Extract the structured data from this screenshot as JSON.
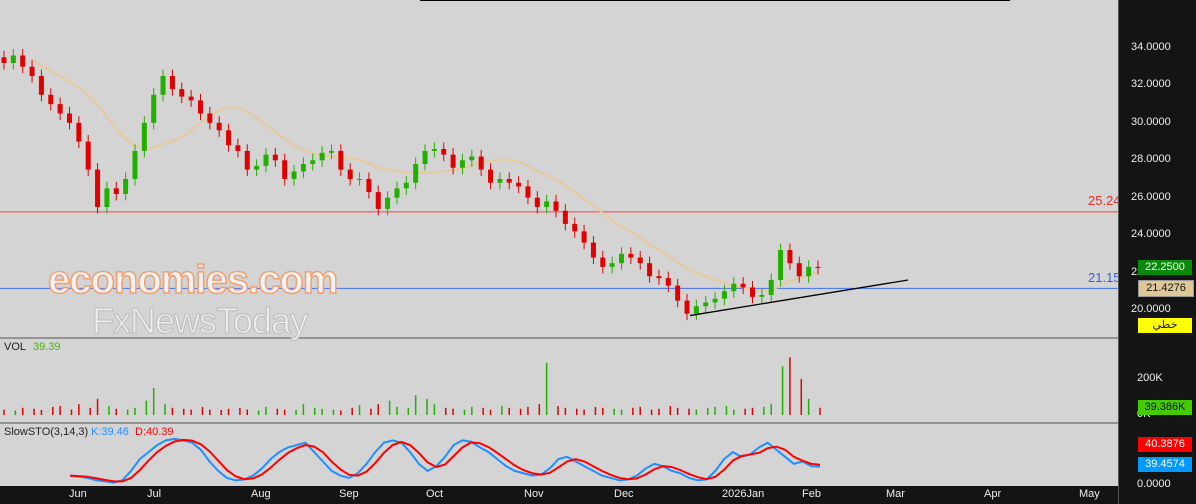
{
  "watermark": {
    "line1": "economies.com",
    "line2": "FxNewsToday"
  },
  "price_axis": {
    "ticks": [
      "34.0000",
      "32.0000",
      "30.0000",
      "28.0000",
      "26.0000",
      "24.0000",
      "22.0000",
      "20.0000"
    ],
    "last": "22.2500",
    "ma": "21.4276",
    "mode": "خطي"
  },
  "levels": {
    "red": "25.24",
    "blue": "21.15"
  },
  "volume": {
    "label": "VOL",
    "value": "39.39",
    "ticks": [
      "200K",
      "0K"
    ],
    "last": "39.386K"
  },
  "stoch": {
    "label": "SlowSTO(3,14,3)",
    "k": "K:39.46",
    "d": "D:40.39",
    "d_last": "40.3876",
    "k_last": "39.4574",
    "tick": "0.0000"
  },
  "months": [
    "Jun",
    "Jul",
    "Aug",
    "Sep",
    "Oct",
    "Nov",
    "Dec",
    "2026Jan",
    "Feb",
    "Mar",
    "Apr",
    "May"
  ],
  "colors": {
    "up": "#22b000",
    "down": "#e00000",
    "ma": "#e8c99a",
    "k": "#1e90ff",
    "d": "#ff0000"
  },
  "chart_data": {
    "type": "candlestick",
    "ylim": [
      19.5,
      35
    ],
    "closes": [
      33.2,
      33.6,
      33,
      32.5,
      31.5,
      31,
      30.5,
      30,
      29,
      27.5,
      25.5,
      26.5,
      26.2,
      27,
      28.5,
      30,
      31.5,
      32.5,
      31.8,
      31.4,
      31.2,
      30.5,
      30,
      29.6,
      28.8,
      28.5,
      27.5,
      27.7,
      28.3,
      28,
      27,
      27.4,
      27.8,
      28,
      28.4,
      28.5,
      27.5,
      27,
      27,
      26.3,
      25.4,
      26,
      26.5,
      26.8,
      27.8,
      28.5,
      28.6,
      28.3,
      27.6,
      28,
      28.2,
      27.5,
      26.8,
      27,
      26.8,
      26.6,
      26,
      25.5,
      25.8,
      25.3,
      24.6,
      24.2,
      23.6,
      22.8,
      22.3,
      22.5,
      23,
      22.8,
      22.5,
      21.8,
      21.7,
      21.3,
      20.5,
      19.8,
      20.2,
      20.4,
      20.6,
      21,
      21.4,
      21.2,
      20.7,
      20.8,
      21.6,
      23.2,
      22.5,
      21.8,
      22.3,
      22.25
    ],
    "volume": [
      30,
      25,
      40,
      35,
      28,
      45,
      50,
      30,
      60,
      40,
      90,
      50,
      35,
      30,
      40,
      80,
      150,
      60,
      40,
      35,
      30,
      45,
      30,
      28,
      35,
      40,
      30,
      25,
      45,
      35,
      30,
      28,
      60,
      40,
      35,
      30,
      25,
      40,
      55,
      35,
      60,
      80,
      45,
      40,
      110,
      90,
      60,
      40,
      35,
      30,
      45,
      40,
      30,
      50,
      40,
      35,
      45,
      60,
      290,
      50,
      40,
      35,
      30,
      45,
      40,
      35,
      30,
      40,
      45,
      30,
      35,
      50,
      40,
      35,
      30,
      40,
      45,
      50,
      30,
      35,
      40,
      45,
      60,
      270,
      320,
      200,
      90,
      40
    ],
    "stoch_k": [
      20,
      18,
      15,
      10,
      8,
      5,
      10,
      30,
      55,
      70,
      85,
      95,
      98,
      95,
      90,
      75,
      50,
      30,
      15,
      10,
      12,
      20,
      35,
      55,
      70,
      80,
      85,
      90,
      70,
      50,
      30,
      20,
      15,
      25,
      45,
      70,
      90,
      95,
      90,
      70,
      45,
      30,
      40,
      60,
      85,
      95,
      92,
      80,
      70,
      55,
      40,
      30,
      25,
      20,
      22,
      35,
      55,
      60,
      50,
      40,
      30,
      20,
      15,
      10,
      12,
      20,
      35,
      45,
      40,
      30,
      25,
      15,
      10,
      12,
      30,
      55,
      70,
      60,
      65,
      80,
      90,
      75,
      60,
      45,
      50,
      40,
      39
    ]
  },
  "trendline": {
    "from": 19.7,
    "to": 21.6
  }
}
